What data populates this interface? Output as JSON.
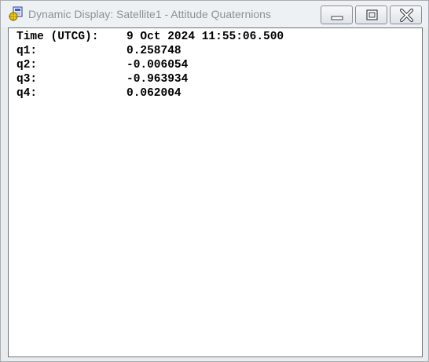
{
  "window": {
    "title": "Dynamic Display:  Satellite1 - Attitude Quaternions",
    "icon": "satellite-app-icon",
    "controls": [
      "minimize-icon",
      "maximize-icon",
      "close-icon"
    ]
  },
  "display": {
    "rows": [
      {
        "label": "Time (UTCG):",
        "value": "9 Oct 2024 11:55:06.500"
      },
      {
        "label": "q1:",
        "value": "0.258748"
      },
      {
        "label": "q2:",
        "value": "-0.006054"
      },
      {
        "label": "q3:",
        "value": "-0.963934"
      },
      {
        "label": "q4:",
        "value": "0.062004"
      }
    ]
  }
}
